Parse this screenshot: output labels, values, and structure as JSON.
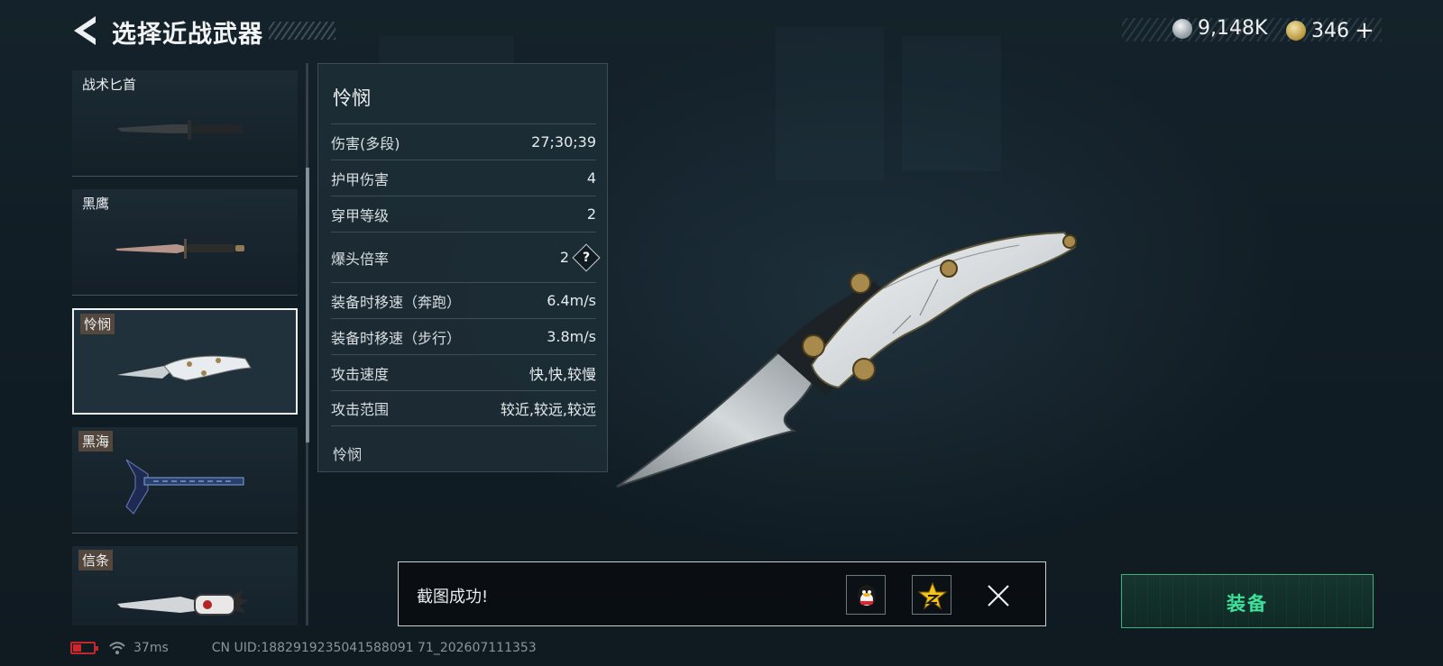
{
  "header": {
    "title": "选择近战武器",
    "currency": [
      {
        "icon": "silver-coin-icon",
        "value": "9,148K"
      },
      {
        "icon": "gold-triangle-coin-icon",
        "value": "346"
      }
    ],
    "add_symbol": "+"
  },
  "weapons": [
    {
      "name": "战术匕首",
      "selected": false
    },
    {
      "name": "黑鹰",
      "selected": false
    },
    {
      "name": "怜悯",
      "selected": true
    },
    {
      "name": "黑海",
      "selected": false
    },
    {
      "name": "信条",
      "selected": false
    }
  ],
  "stats": {
    "title": "怜悯",
    "rows": [
      {
        "label": "伤害(多段)",
        "value": "27;30;39"
      },
      {
        "label": "护甲伤害",
        "value": "4"
      },
      {
        "label": "穿甲等级",
        "value": "2"
      },
      {
        "label": "爆头倍率",
        "value": "2",
        "help": "?"
      },
      {
        "label": "装备时移速（奔跑）",
        "value": "6.4m/s"
      },
      {
        "label": "装备时移速（步行）",
        "value": "3.8m/s"
      },
      {
        "label": "攻击速度",
        "value": "快,快,较慢"
      },
      {
        "label": "攻击范围",
        "value": "较近,较远,较远"
      }
    ],
    "footer": "怜悯"
  },
  "toast": {
    "message": "截图成功!",
    "share_targets": [
      "qq-icon",
      "qzone-icon"
    ]
  },
  "equip_button": "装备",
  "status_bar": {
    "ping": "37ms",
    "uid": "CN UID:1882919235041588091 71_202607111353",
    "battery_color": "#d2242b"
  },
  "colors": {
    "accent_green": "#3ee09a",
    "background": "#111d25"
  }
}
